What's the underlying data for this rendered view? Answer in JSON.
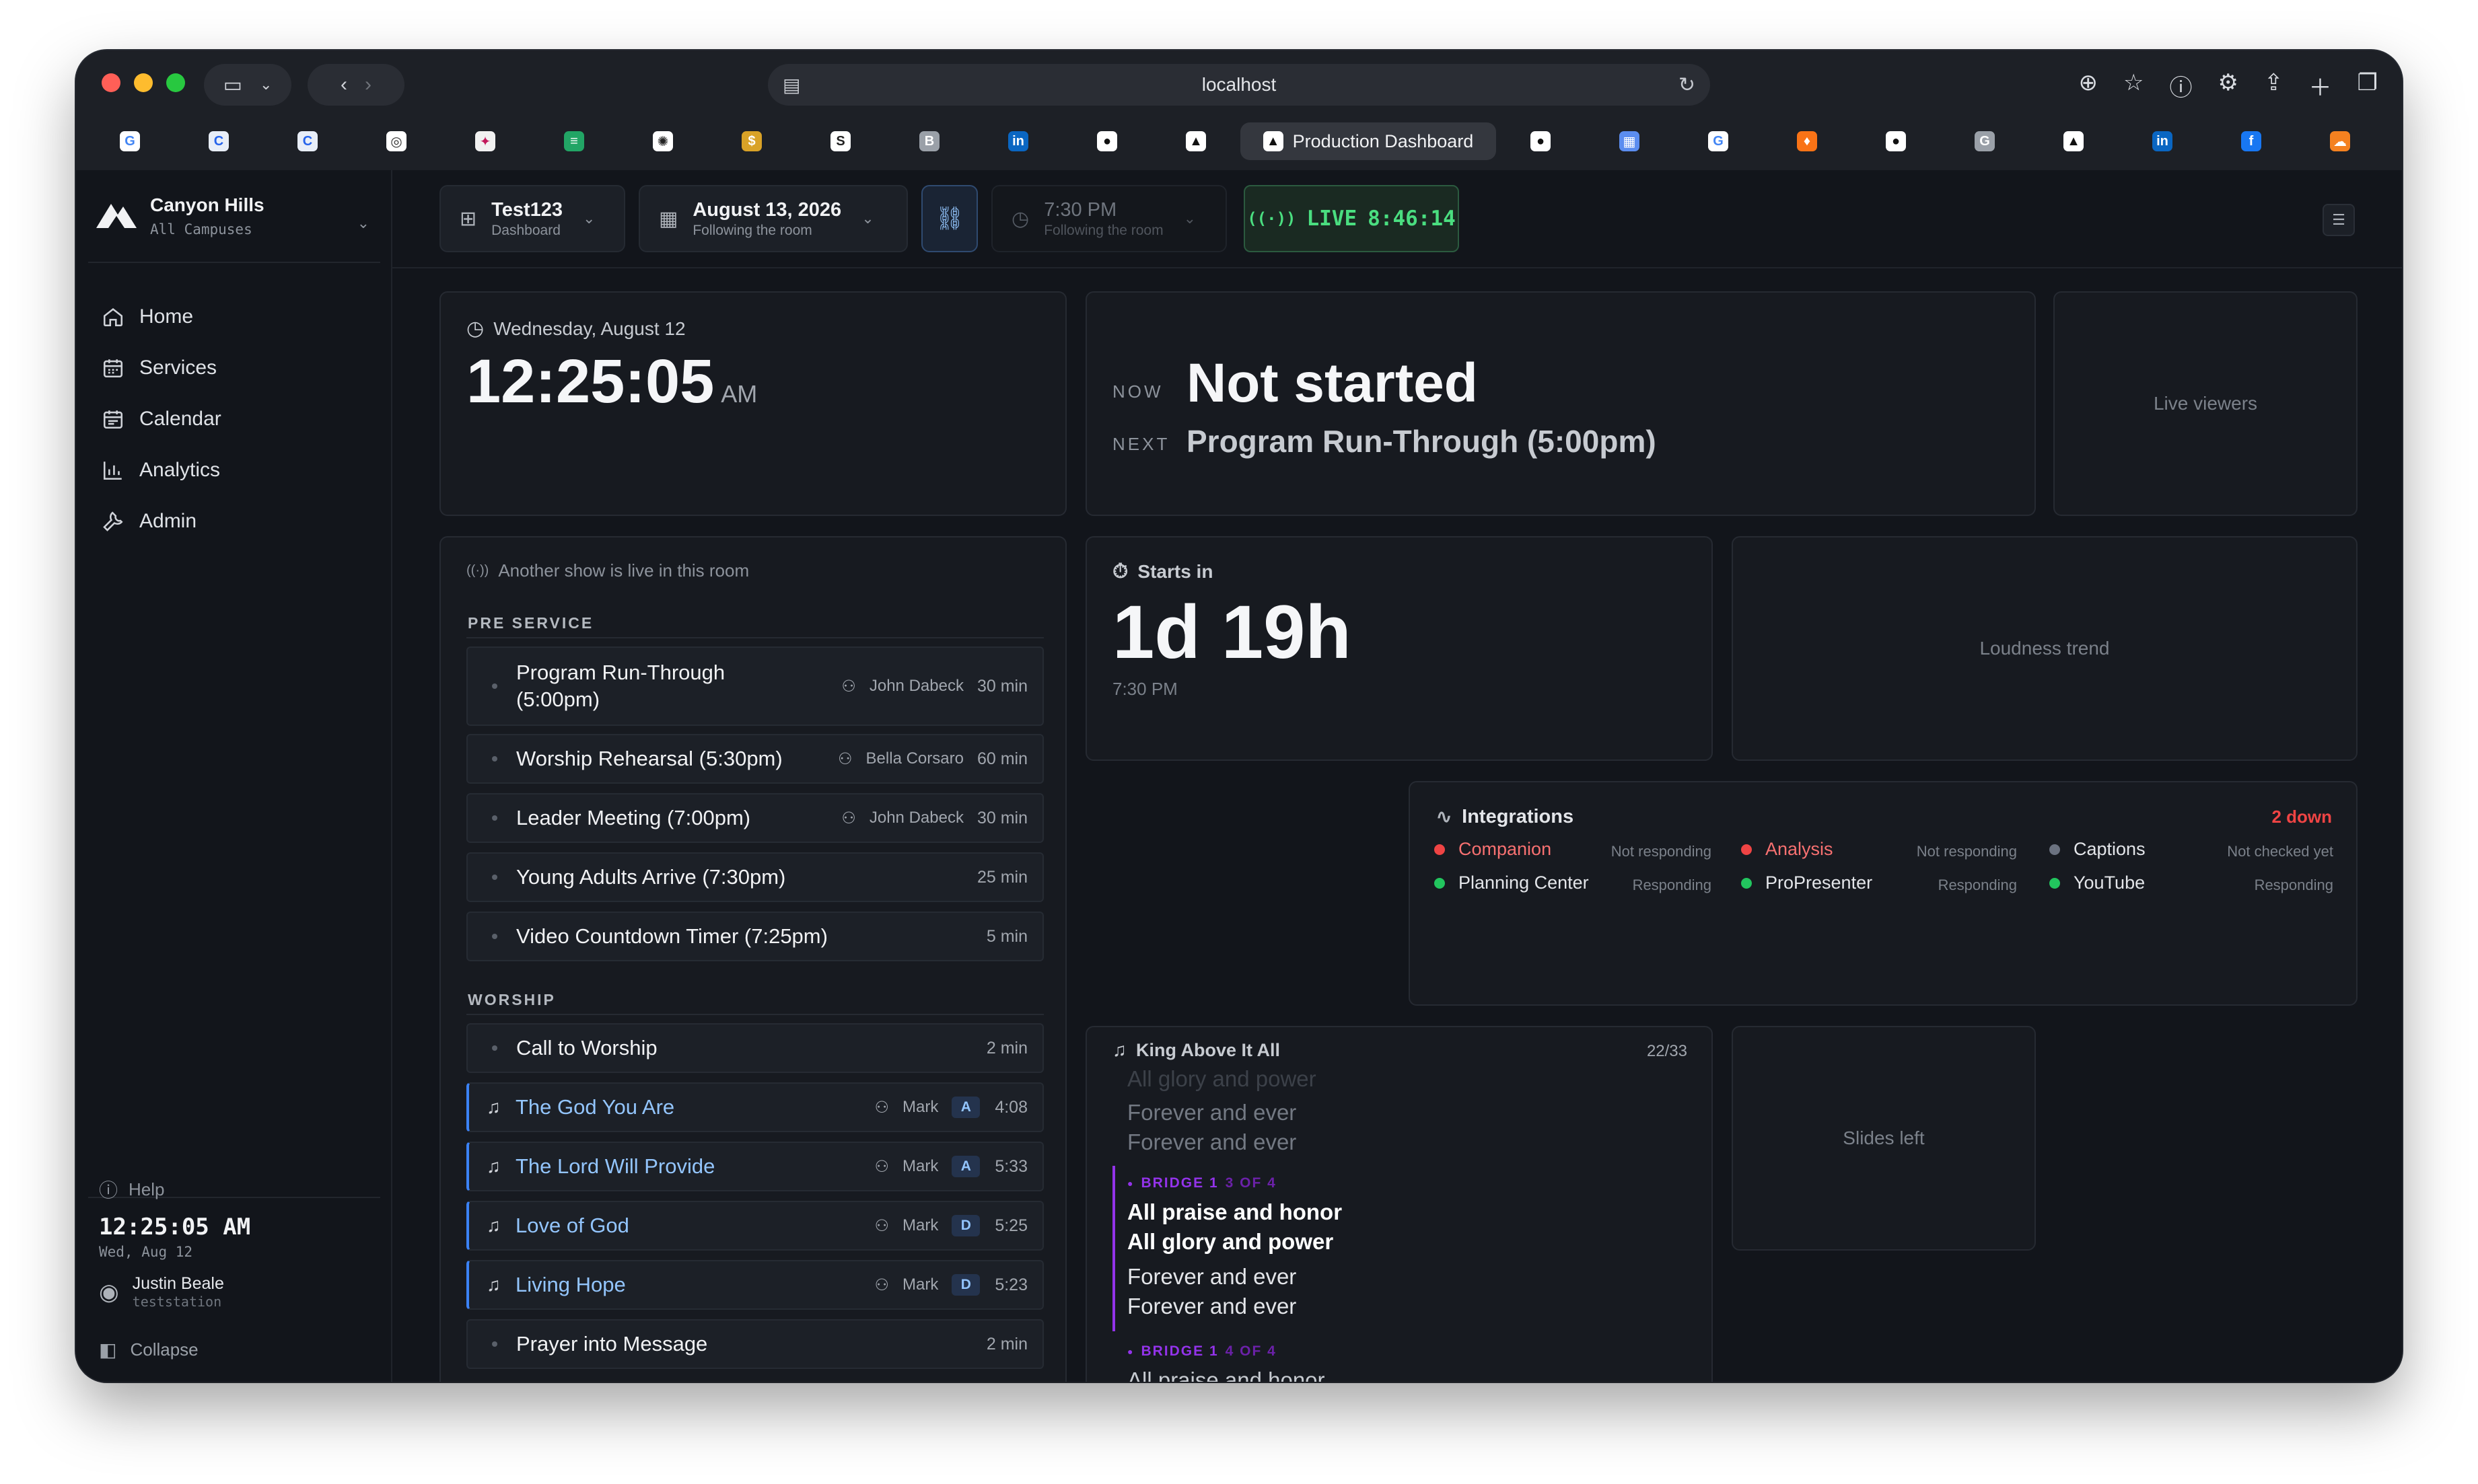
{
  "browser": {
    "url": "localhost",
    "active_tab": "Production Dashboard",
    "tab_favicons": [
      {
        "icon": "google-icon",
        "label": "G",
        "color": "#ffffff",
        "fg": "#4285f4"
      },
      {
        "icon": "c-icon",
        "label": "C",
        "color": "#e8eef8",
        "fg": "#2563eb"
      },
      {
        "icon": "c-icon",
        "label": "C",
        "color": "#e8eef8",
        "fg": "#2563eb"
      },
      {
        "icon": "circle-logo-icon",
        "label": "◎",
        "color": "#ffffff",
        "fg": "#333333"
      },
      {
        "icon": "bird-icon",
        "label": "✦",
        "color": "#f1f1f1",
        "fg": "#c2185b"
      },
      {
        "icon": "sheets-icon",
        "label": "≡",
        "color": "#22a565",
        "fg": "#ffffff"
      },
      {
        "icon": "openai-icon",
        "label": "✺",
        "color": "#ffffff",
        "fg": "#222222"
      },
      {
        "icon": "coin-icon",
        "label": "$",
        "color": "#d9a227",
        "fg": "#ffffff"
      },
      {
        "icon": "s-icon",
        "label": "S",
        "color": "#ffffff",
        "fg": "#222222"
      },
      {
        "icon": "b-icon",
        "label": "B",
        "color": "#9aa0a8",
        "fg": "#ffffff"
      },
      {
        "icon": "linkedin-icon",
        "label": "in",
        "color": "#0a66c2",
        "fg": "#ffffff"
      },
      {
        "icon": "github-icon",
        "label": "●",
        "color": "#ffffff",
        "fg": "#111111"
      },
      {
        "icon": "mountain-icon",
        "label": "▲",
        "color": "#ffffff",
        "fg": "#111111"
      },
      {
        "icon": "github-icon",
        "label": "●",
        "color": "#ffffff",
        "fg": "#111111"
      },
      {
        "icon": "calendar-app-icon",
        "label": "▦",
        "color": "#5b8def",
        "fg": "#ffffff"
      },
      {
        "icon": "google-icon",
        "label": "G",
        "color": "#ffffff",
        "fg": "#4285f4"
      },
      {
        "icon": "brave-icon",
        "label": "♦",
        "color": "#f97316",
        "fg": "#ffffff"
      },
      {
        "icon": "github-icon",
        "label": "●",
        "color": "#ffffff",
        "fg": "#111111"
      },
      {
        "icon": "g-icon",
        "label": "G",
        "color": "#9aa0a8",
        "fg": "#ffffff"
      },
      {
        "icon": "mountain-icon",
        "label": "▲",
        "color": "#ffffff",
        "fg": "#111111"
      },
      {
        "icon": "linkedin-icon",
        "label": "in",
        "color": "#0a66c2",
        "fg": "#ffffff"
      },
      {
        "icon": "facebook-icon",
        "label": "f",
        "color": "#1877f2",
        "fg": "#ffffff"
      },
      {
        "icon": "cloud-icon",
        "label": "☁",
        "color": "#f48120",
        "fg": "#ffffff"
      }
    ]
  },
  "sidebar": {
    "org_name": "Canyon Hills",
    "org_sub": "All Campuses",
    "nav": [
      {
        "label": "Home",
        "icon": "home-icon"
      },
      {
        "label": "Services",
        "icon": "services-icon"
      },
      {
        "label": "Calendar",
        "icon": "calendar-icon"
      },
      {
        "label": "Analytics",
        "icon": "analytics-icon"
      },
      {
        "label": "Admin",
        "icon": "wrench-icon"
      }
    ],
    "help": "Help",
    "clock": "12:25:05 AM",
    "clock_date": "Wed, Aug 12",
    "user_name": "Justin Beale",
    "user_sub": "teststation",
    "collapse": "Collapse"
  },
  "topbar": {
    "dashboard_title": "Test123",
    "dashboard_sub": "Dashboard",
    "date_title": "August 13, 2026",
    "date_sub": "Following the room",
    "time_title": "7:30 PM",
    "time_sub": "Following the room",
    "live_label": "LIVE",
    "live_timer": "8:46:14"
  },
  "clock_card": {
    "date": "Wednesday, August 12",
    "time": "12:25:05",
    "ampm": "AM"
  },
  "now_next": {
    "now_label": "NOW",
    "now_value": "Not started",
    "next_label": "NEXT",
    "next_value": "Program Run-Through (5:00pm)"
  },
  "placeholders": {
    "live_viewers": "Live viewers",
    "loudness_trend": "Loudness trend",
    "slides_left": "Slides left"
  },
  "run_of_show": {
    "notice": "Another show is live in this room",
    "sections": [
      {
        "name": "PRE SERVICE",
        "items": [
          {
            "title_line1": "Program Run-Through",
            "title_line2": "(5:00pm)",
            "person": "John Dabeck",
            "duration": "30 min"
          },
          {
            "title": "Worship Rehearsal (5:30pm)",
            "person": "Bella Corsaro",
            "duration": "60 min"
          },
          {
            "title": "Leader Meeting (7:00pm)",
            "person": "John Dabeck",
            "duration": "30 min"
          },
          {
            "title": "Young Adults Arrive (7:30pm)",
            "duration": "25 min"
          },
          {
            "title": "Video Countdown Timer (7:25pm)",
            "duration": "5 min"
          }
        ]
      },
      {
        "name": "WORSHIP",
        "items": [
          {
            "title": "Call to Worship",
            "duration": "2 min"
          },
          {
            "title": "The God You Are",
            "person": "Mark",
            "key": "A",
            "duration": "4:08",
            "song": true
          },
          {
            "title": "The Lord Will Provide",
            "person": "Mark",
            "key": "A",
            "duration": "5:33",
            "song": true
          },
          {
            "title": "Love of God",
            "person": "Mark",
            "key": "D",
            "duration": "5:25",
            "song": true
          },
          {
            "title": "Living Hope",
            "person": "Mark",
            "key": "D",
            "duration": "5:23",
            "song": true
          },
          {
            "title": "Prayer into Message",
            "duration": "2 min"
          }
        ]
      }
    ]
  },
  "starts_in": {
    "label": "Starts in",
    "value": "1d 19h",
    "time": "7:30 PM"
  },
  "integrations": {
    "title": "Integrations",
    "down_count": "2 down",
    "items": [
      {
        "name": "Companion",
        "status": "Not responding",
        "color": "#ef4444",
        "state": "down"
      },
      {
        "name": "Analysis",
        "status": "Not responding",
        "color": "#ef4444",
        "state": "down"
      },
      {
        "name": "Captions",
        "status": "Not checked yet",
        "color": "#6b7280",
        "state": "unknown"
      },
      {
        "name": "Planning Center",
        "status": "Responding",
        "color": "#22c55e",
        "state": "ok"
      },
      {
        "name": "ProPresenter",
        "status": "Responding",
        "color": "#22c55e",
        "state": "ok"
      },
      {
        "name": "YouTube",
        "status": "Responding",
        "color": "#22c55e",
        "state": "ok"
      }
    ]
  },
  "lyrics": {
    "song": "King Above It All",
    "slide_count": "22/33",
    "prev_lines": [
      "All glory and power",
      "Forever and ever",
      "Forever and ever"
    ],
    "current_tag": "BRIDGE 1",
    "current_pos": "3 OF 4",
    "current_lines": [
      "All praise and honor",
      "All glory and power"
    ],
    "current_sub": [
      "Forever and ever",
      "Forever and ever"
    ],
    "next_tag": "BRIDGE 1",
    "next_pos": "4 OF 4",
    "next_lines": [
      "All praise and honor"
    ]
  }
}
